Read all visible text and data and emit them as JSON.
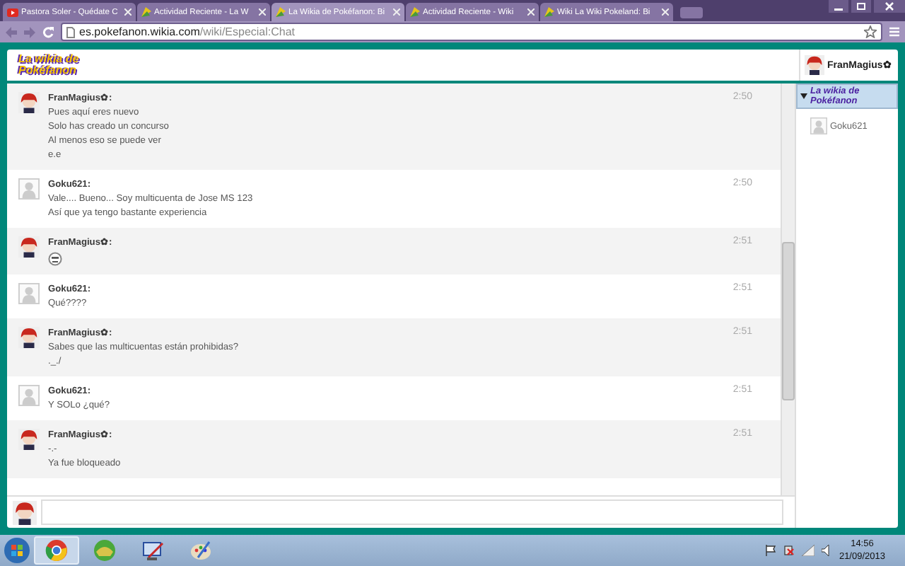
{
  "browser": {
    "tabs": [
      {
        "title": "Pastora Soler - Quédate C",
        "kind": "video",
        "selected": false
      },
      {
        "title": "Actividad Reciente - La W",
        "kind": "wiki",
        "selected": false
      },
      {
        "title": "La Wikia de Pokéfanon: Bi",
        "kind": "wiki",
        "selected": true
      },
      {
        "title": "Actividad Reciente - Wiki",
        "kind": "wiki",
        "selected": false
      },
      {
        "title": "Wiki La Wiki Pokeland: Bi",
        "kind": "wiki",
        "selected": false
      }
    ],
    "address": {
      "host": "es.pokefanon.wikia.com",
      "path": "/wiki/Especial:Chat"
    }
  },
  "chat": {
    "logo": "La wikia de Pokéfanon",
    "current_user": {
      "name": "FranMagius✿"
    },
    "messages": [
      {
        "user": "FranMagius✿:",
        "kind": "character",
        "shaded": true,
        "time": "2:50",
        "lines": [
          {
            "kind": "text",
            "text": "Pues aquí eres nuevo"
          },
          {
            "kind": "text",
            "text": "Solo has creado un concurso"
          },
          {
            "kind": "text",
            "text": "Al menos eso se puede ver"
          },
          {
            "kind": "text",
            "text": "e.e"
          }
        ]
      },
      {
        "user": "Goku621:",
        "kind": "default",
        "shaded": false,
        "time": "2:50",
        "lines": [
          {
            "kind": "text",
            "text": "Vale.... Bueno... Soy multicuenta de Jose MS 123"
          },
          {
            "kind": "text",
            "text": "Así que ya tengo bastante experiencia"
          }
        ]
      },
      {
        "user": "FranMagius✿:",
        "kind": "character",
        "shaded": true,
        "time": "2:51",
        "lines": [
          {
            "kind": "emoticon"
          }
        ]
      },
      {
        "user": "Goku621:",
        "kind": "default",
        "shaded": false,
        "time": "2:51",
        "lines": [
          {
            "kind": "text",
            "text": "Qué????"
          }
        ]
      },
      {
        "user": "FranMagius✿:",
        "kind": "character",
        "shaded": true,
        "time": "2:51",
        "lines": [
          {
            "kind": "text",
            "text": "Sabes que las multicuentas están prohibidas?"
          },
          {
            "kind": "text",
            "text": "._./"
          }
        ]
      },
      {
        "user": "Goku621:",
        "kind": "default",
        "shaded": false,
        "time": "2:51",
        "lines": [
          {
            "kind": "text",
            "text": "Y SOLo ¿qué?"
          }
        ]
      },
      {
        "user": "FranMagius✿:",
        "kind": "character",
        "shaded": true,
        "time": "2:51",
        "lines": [
          {
            "kind": "text",
            "text": "-.-"
          },
          {
            "kind": "text",
            "text": "Ya fue bloqueado"
          }
        ]
      }
    ],
    "sidebar": {
      "logo": "La wikia de Pokéfanon",
      "expanded": true,
      "users": [
        {
          "name": "Goku621",
          "kind": "default"
        }
      ]
    }
  },
  "taskbar": {
    "apps": [
      {
        "kind": "browser",
        "selected": true
      },
      {
        "kind": "game",
        "selected": false
      },
      {
        "kind": "editor",
        "selected": false
      },
      {
        "kind": "paint",
        "selected": false
      }
    ],
    "time": "14:56",
    "date": "21/09/2013"
  }
}
